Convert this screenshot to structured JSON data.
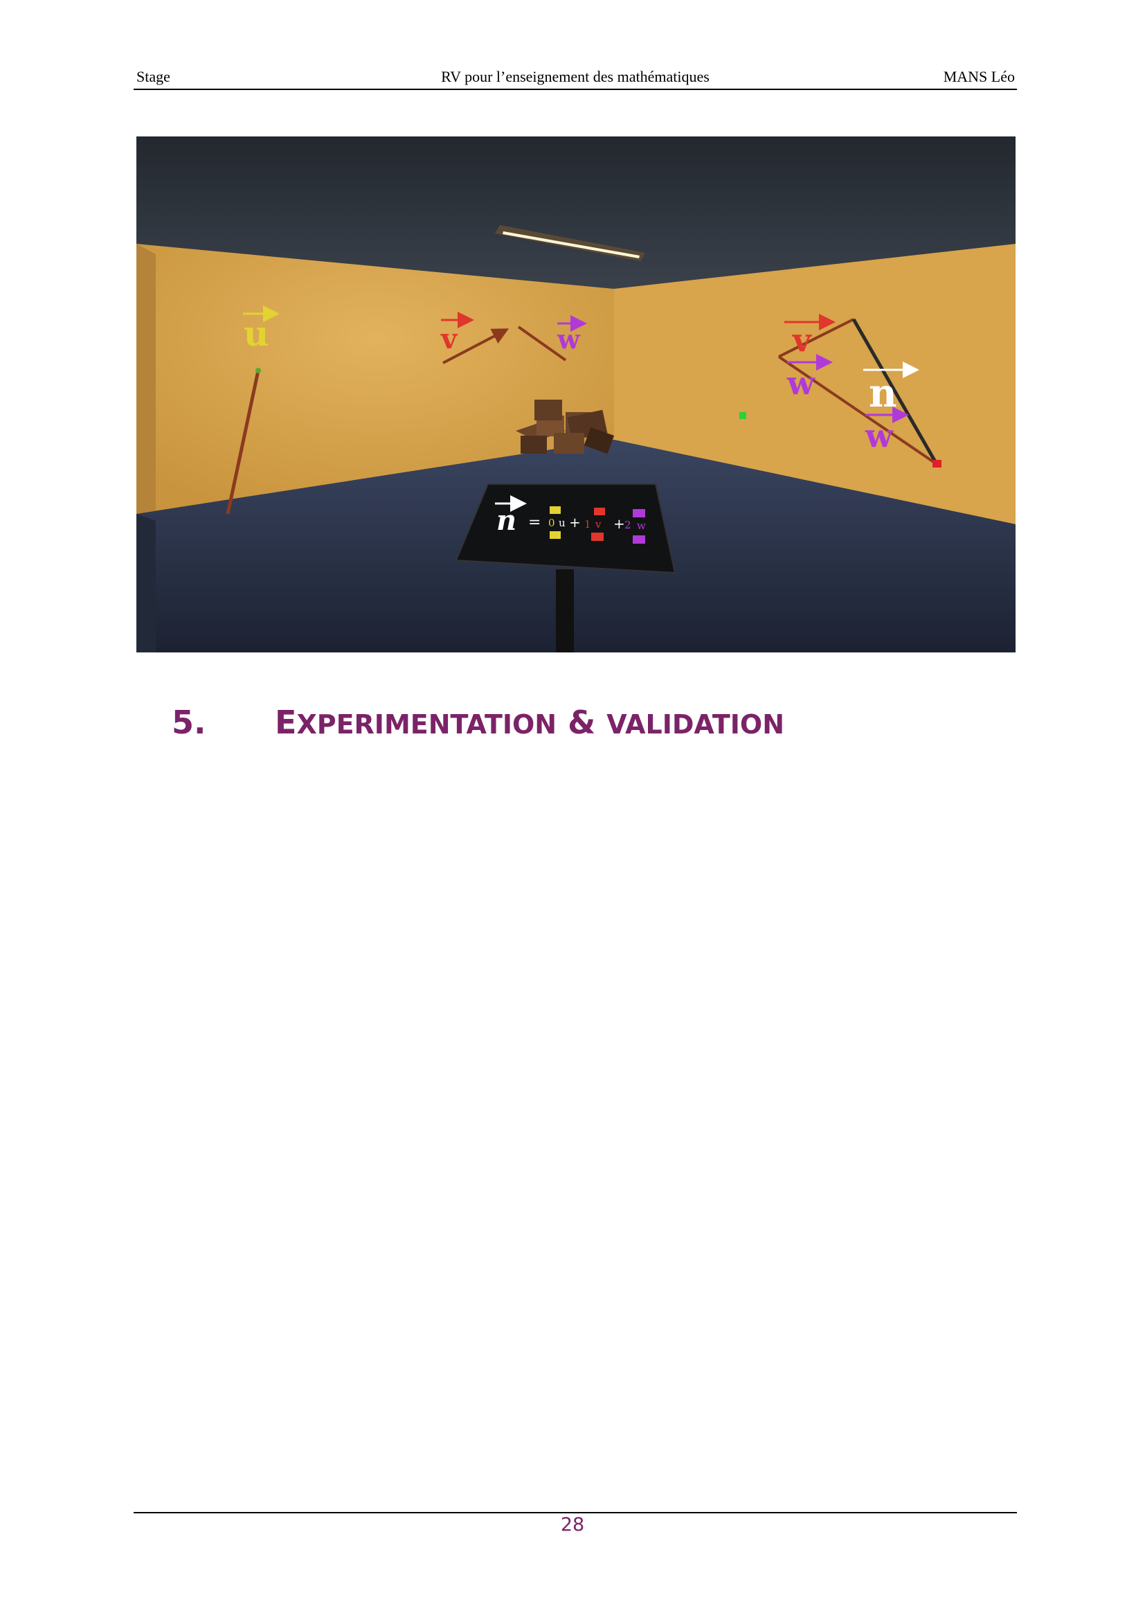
{
  "header": {
    "left": "Stage",
    "center": "RV pour l’enseignement des mathématiques",
    "right": "MANS Léo"
  },
  "figure": {
    "vectors": {
      "u": "u",
      "v": "v",
      "w": "w",
      "n": "n"
    },
    "panel": {
      "lhs": "n",
      "equals": "=",
      "coef_u": "0",
      "coef_v": "1",
      "coef_w": "2",
      "plus": "+"
    },
    "colors": {
      "wall": "#d4a047",
      "ceiling": "#2c323a",
      "floor": "#2a3346",
      "vector_u": "#e3d332",
      "vector_v": "#e0362c",
      "vector_w": "#b03ad8",
      "vector_n": "#ffffff",
      "rod": "#8b3a1e"
    }
  },
  "section": {
    "number": "5.",
    "title_cap1": "E",
    "title_rest1": "XPERIMENTATION",
    "title_amp": " & ",
    "title_rest2": "VALIDATION"
  },
  "footer": {
    "page_number": "28"
  }
}
